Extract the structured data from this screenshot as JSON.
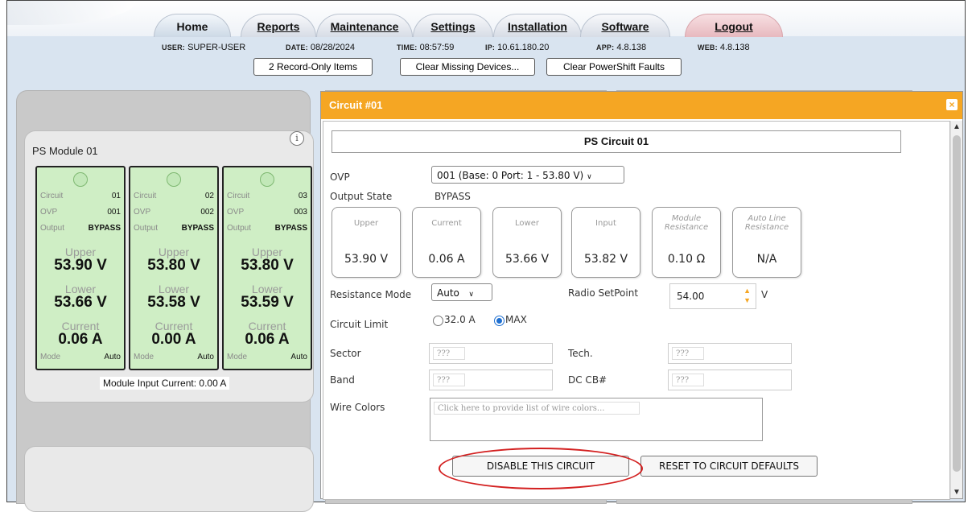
{
  "nav": {
    "tabs": [
      "Home",
      "Reports",
      "Maintenance",
      "Settings",
      "Installation",
      "Software"
    ],
    "logout": "Logout"
  },
  "info": {
    "user_label": "USER:",
    "user": "SUPER-USER",
    "date_label": "DATE:",
    "date": "08/28/2024",
    "time_label": "TIME:",
    "time": "08:57:59",
    "ip_label": "IP:",
    "ip": "10.61.180.20",
    "app_label": "APP:",
    "app": "4.8.138",
    "web_label": "WEB:",
    "web": "4.8.138"
  },
  "header_buttons": {
    "record_only": "2 Record-Only Items",
    "clear_missing": "Clear Missing Devices...",
    "clear_powershift": "Clear PowerShift Faults"
  },
  "module": {
    "title": "PS Module 01",
    "info_glyph": "i",
    "footer": "Module Input Current: 0.00 A",
    "cards": [
      {
        "circuit_label": "Circuit",
        "circuit": "01",
        "ovp_label": "OVP",
        "ovp": "001",
        "output_label": "Output",
        "output": "BYPASS",
        "upper_label": "Upper",
        "upper": "53.90 V",
        "lower_label": "Lower",
        "lower": "53.66 V",
        "current_label": "Current",
        "current": "0.06 A",
        "mode_label": "Mode",
        "mode": "Auto"
      },
      {
        "circuit_label": "Circuit",
        "circuit": "02",
        "ovp_label": "OVP",
        "ovp": "002",
        "output_label": "Output",
        "output": "BYPASS",
        "upper_label": "Upper",
        "upper": "53.80 V",
        "lower_label": "Lower",
        "lower": "53.58 V",
        "current_label": "Current",
        "current": "0.00 A",
        "mode_label": "Mode",
        "mode": "Auto"
      },
      {
        "circuit_label": "Circuit",
        "circuit": "03",
        "ovp_label": "OVP",
        "ovp": "003",
        "output_label": "Output",
        "output": "BYPASS",
        "upper_label": "Upper",
        "upper": "53.80 V",
        "lower_label": "Lower",
        "lower": "53.59 V",
        "current_label": "Current",
        "current": "0.06 A",
        "mode_label": "Mode",
        "mode": "Auto"
      }
    ]
  },
  "dialog": {
    "title": "Circuit #01",
    "close_glyph": "×",
    "circuit_name": "PS Circuit 01",
    "ovp_label": "OVP",
    "ovp_value": "001 (Base: 0 Port: 1 - 53.80 V)",
    "output_state_label": "Output State",
    "output_state_value": "BYPASS",
    "meters": [
      {
        "label": "Upper",
        "value": "53.90 V"
      },
      {
        "label": "Current",
        "value": "0.06 A"
      },
      {
        "label": "Lower",
        "value": "53.66 V"
      },
      {
        "label": "Input",
        "value": "53.82 V"
      },
      {
        "label": "Module Resistance",
        "value": "0.10 Ω"
      },
      {
        "label": "Auto Line Resistance",
        "value": "N/A"
      }
    ],
    "resistance_mode_label": "Resistance Mode",
    "resistance_mode_value": "Auto",
    "radio_setpoint_label": "Radio SetPoint",
    "radio_setpoint_value": "54.00",
    "radio_setpoint_unit": "V",
    "circuit_limit_label": "Circuit Limit",
    "limit_options": [
      "32.0 A",
      "MAX"
    ],
    "limit_selected": "MAX",
    "sector_label": "Sector",
    "sector_value": "???",
    "tech_label": "Tech.",
    "tech_value": "???",
    "band_label": "Band",
    "band_value": "???",
    "dc_cb_label": "DC CB#",
    "dc_cb_value": "???",
    "wire_colors_label": "Wire Colors",
    "wire_colors_placeholder": "Click here to provide list of wire colors...",
    "disable_button": "DISABLE THIS CIRCUIT",
    "reset_button": "RESET TO CIRCUIT DEFAULTS"
  },
  "colors": {
    "dialog_header": "#f5a623",
    "card_bg": "#cfeec5",
    "highlight_oval": "#d32020",
    "radio_selected": "#1e6fd0"
  }
}
